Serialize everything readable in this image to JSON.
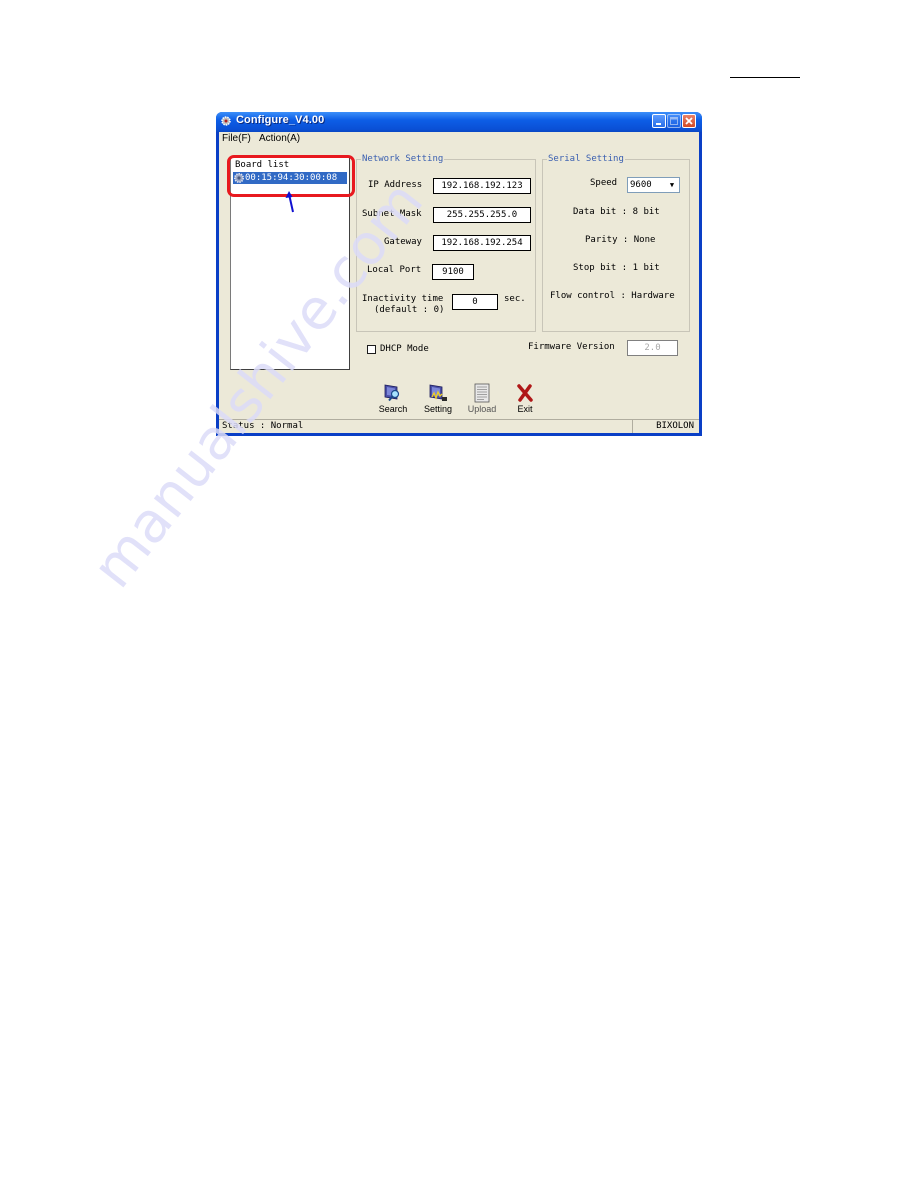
{
  "page": {
    "watermark_text": "manualshive.com"
  },
  "window": {
    "title": "Configure_V4.00",
    "controls": {
      "minimize": "minimize",
      "maximize": "maximize",
      "close": "close"
    }
  },
  "menu": {
    "items": [
      {
        "label": "File(F)"
      },
      {
        "label": "Action(A)"
      }
    ]
  },
  "board_list": {
    "title": "Board list",
    "items": [
      {
        "mac": "00:15:94:30:00:08",
        "selected": true,
        "icon": "gear-icon"
      }
    ]
  },
  "annotation": {
    "highlight_color": "#e8191f",
    "arrow_color": "#1010d0"
  },
  "network_setting": {
    "legend": "Network Setting",
    "ip_label": "IP Address",
    "ip_value": "192.168.192.123",
    "subnet_label": "Subnet Mask",
    "subnet_value": "255.255.255.0",
    "gateway_label": "Gateway",
    "gateway_value": "192.168.192.254",
    "port_label": "Local Port",
    "port_value": "9100",
    "inactivity_label": "Inactivity time",
    "inactivity_default": "(default : 0)",
    "inactivity_value": "0",
    "inactivity_unit": "sec."
  },
  "serial_setting": {
    "legend": "Serial Setting",
    "speed_label": "Speed",
    "speed_value": "9600",
    "data_bit": "Data bit : 8 bit",
    "parity": "Parity : None",
    "stop_bit": "Stop bit : 1 bit",
    "flow_control": "Flow control : Hardware"
  },
  "dhcp": {
    "label": "DHCP Mode",
    "checked": false
  },
  "firmware": {
    "label": "Firmware Version",
    "value": "2.0"
  },
  "toolbar": {
    "search": "Search",
    "setting": "Setting",
    "upload": "Upload",
    "exit": "Exit"
  },
  "status": {
    "text": "Status : Normal",
    "brand": "BIXOLON"
  }
}
